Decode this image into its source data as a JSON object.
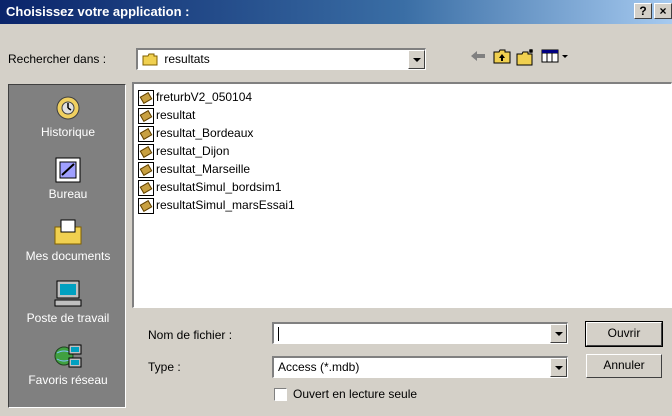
{
  "window": {
    "title": "Choisissez votre application :",
    "help_btn": "?",
    "close_btn": "×"
  },
  "lookin": {
    "label": "Rechercher dans :",
    "value": "resultats"
  },
  "toolbar": {
    "icons": [
      "back-icon",
      "up-folder-icon",
      "new-folder-icon",
      "view-menu-icon"
    ]
  },
  "places": [
    {
      "label": "Historique",
      "icon": "history-icon"
    },
    {
      "label": "Bureau",
      "icon": "desktop-icon"
    },
    {
      "label": "Mes documents",
      "icon": "my-documents-icon"
    },
    {
      "label": "Poste de travail",
      "icon": "my-computer-icon"
    },
    {
      "label": "Favoris réseau",
      "icon": "network-places-icon"
    }
  ],
  "files": [
    "freturbV2_050104",
    "resultat",
    "resultat_Bordeaux",
    "resultat_Dijon",
    "resultat_Marseille",
    "resultatSimul_bordsim1",
    "resultatSimul_marsEssai1"
  ],
  "filename": {
    "label": "Nom de fichier :",
    "value": ""
  },
  "filetype": {
    "label": "Type :",
    "value": "Access (*.mdb)"
  },
  "readonly": {
    "label": "Ouvert en lecture seule",
    "checked": false
  },
  "buttons": {
    "open": "Ouvrir",
    "cancel": "Annuler"
  }
}
